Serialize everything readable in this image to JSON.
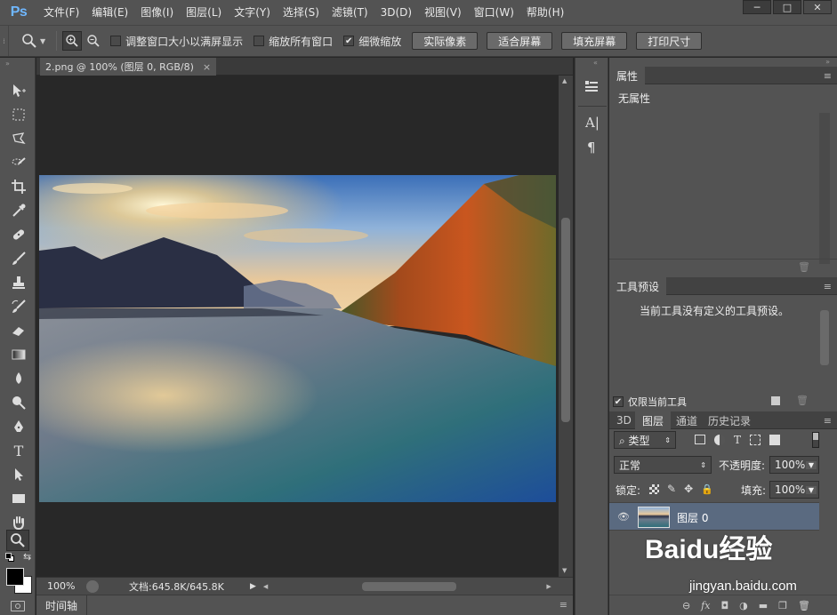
{
  "app": {
    "logo": "Ps"
  },
  "menu": [
    "文件(F)",
    "编辑(E)",
    "图像(I)",
    "图层(L)",
    "文字(Y)",
    "选择(S)",
    "滤镜(T)",
    "3D(D)",
    "视图(V)",
    "窗口(W)",
    "帮助(H)"
  ],
  "options": {
    "resize_windows": "调整窗口大小以满屏显示",
    "zoom_all": "缩放所有窗口",
    "scrubby_zoom": "细微缩放",
    "actual_pixels": "实际像素",
    "fit_screen": "适合屏幕",
    "fill_screen": "填充屏幕",
    "print_size": "打印尺寸"
  },
  "document": {
    "tab_title": "2.png @ 100% (图层 0, RGB/8)",
    "zoom": "100%",
    "doc_size": "文档:645.8K/645.8K"
  },
  "timeline": {
    "label": "时间轴"
  },
  "properties": {
    "tab": "属性",
    "content": "无属性"
  },
  "tool_presets": {
    "tab": "工具预设",
    "content": "当前工具没有定义的工具预设。",
    "current_only": "仅限当前工具"
  },
  "layers": {
    "tabs": [
      "3D",
      "图层",
      "通道",
      "历史记录"
    ],
    "filter_kind": "类型",
    "blend_mode": "正常",
    "opacity_label": "不透明度:",
    "opacity_value": "100%",
    "lock_label": "锁定:",
    "fill_label": "填充:",
    "fill_value": "100%",
    "items": [
      {
        "name": "图层 0",
        "visible": true
      }
    ]
  },
  "watermark": {
    "brand": "Baidu经验",
    "url": "jingyan.baidu.com"
  },
  "colors": {
    "accent": "#6fb7ff",
    "panel": "#535353",
    "canvas": "#282828",
    "selected_layer": "#5a6a80"
  }
}
